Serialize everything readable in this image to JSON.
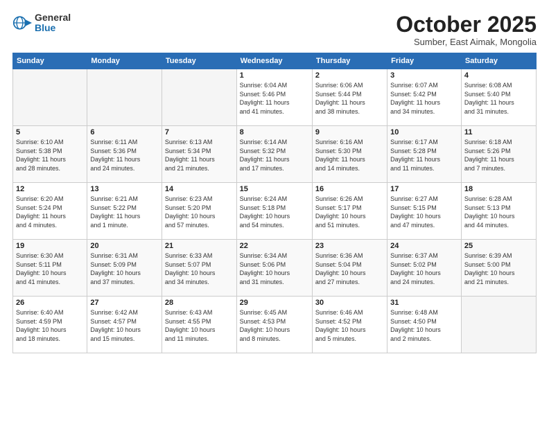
{
  "header": {
    "logo": {
      "general": "General",
      "blue": "Blue"
    },
    "title": "October 2025",
    "subtitle": "Sumber, East Aimak, Mongolia"
  },
  "days_of_week": [
    "Sunday",
    "Monday",
    "Tuesday",
    "Wednesday",
    "Thursday",
    "Friday",
    "Saturday"
  ],
  "weeks": [
    [
      {
        "day": "",
        "info": ""
      },
      {
        "day": "",
        "info": ""
      },
      {
        "day": "",
        "info": ""
      },
      {
        "day": "1",
        "info": "Sunrise: 6:04 AM\nSunset: 5:46 PM\nDaylight: 11 hours\nand 41 minutes."
      },
      {
        "day": "2",
        "info": "Sunrise: 6:06 AM\nSunset: 5:44 PM\nDaylight: 11 hours\nand 38 minutes."
      },
      {
        "day": "3",
        "info": "Sunrise: 6:07 AM\nSunset: 5:42 PM\nDaylight: 11 hours\nand 34 minutes."
      },
      {
        "day": "4",
        "info": "Sunrise: 6:08 AM\nSunset: 5:40 PM\nDaylight: 11 hours\nand 31 minutes."
      }
    ],
    [
      {
        "day": "5",
        "info": "Sunrise: 6:10 AM\nSunset: 5:38 PM\nDaylight: 11 hours\nand 28 minutes."
      },
      {
        "day": "6",
        "info": "Sunrise: 6:11 AM\nSunset: 5:36 PM\nDaylight: 11 hours\nand 24 minutes."
      },
      {
        "day": "7",
        "info": "Sunrise: 6:13 AM\nSunset: 5:34 PM\nDaylight: 11 hours\nand 21 minutes."
      },
      {
        "day": "8",
        "info": "Sunrise: 6:14 AM\nSunset: 5:32 PM\nDaylight: 11 hours\nand 17 minutes."
      },
      {
        "day": "9",
        "info": "Sunrise: 6:16 AM\nSunset: 5:30 PM\nDaylight: 11 hours\nand 14 minutes."
      },
      {
        "day": "10",
        "info": "Sunrise: 6:17 AM\nSunset: 5:28 PM\nDaylight: 11 hours\nand 11 minutes."
      },
      {
        "day": "11",
        "info": "Sunrise: 6:18 AM\nSunset: 5:26 PM\nDaylight: 11 hours\nand 7 minutes."
      }
    ],
    [
      {
        "day": "12",
        "info": "Sunrise: 6:20 AM\nSunset: 5:24 PM\nDaylight: 11 hours\nand 4 minutes."
      },
      {
        "day": "13",
        "info": "Sunrise: 6:21 AM\nSunset: 5:22 PM\nDaylight: 11 hours\nand 1 minute."
      },
      {
        "day": "14",
        "info": "Sunrise: 6:23 AM\nSunset: 5:20 PM\nDaylight: 10 hours\nand 57 minutes."
      },
      {
        "day": "15",
        "info": "Sunrise: 6:24 AM\nSunset: 5:18 PM\nDaylight: 10 hours\nand 54 minutes."
      },
      {
        "day": "16",
        "info": "Sunrise: 6:26 AM\nSunset: 5:17 PM\nDaylight: 10 hours\nand 51 minutes."
      },
      {
        "day": "17",
        "info": "Sunrise: 6:27 AM\nSunset: 5:15 PM\nDaylight: 10 hours\nand 47 minutes."
      },
      {
        "day": "18",
        "info": "Sunrise: 6:28 AM\nSunset: 5:13 PM\nDaylight: 10 hours\nand 44 minutes."
      }
    ],
    [
      {
        "day": "19",
        "info": "Sunrise: 6:30 AM\nSunset: 5:11 PM\nDaylight: 10 hours\nand 41 minutes."
      },
      {
        "day": "20",
        "info": "Sunrise: 6:31 AM\nSunset: 5:09 PM\nDaylight: 10 hours\nand 37 minutes."
      },
      {
        "day": "21",
        "info": "Sunrise: 6:33 AM\nSunset: 5:07 PM\nDaylight: 10 hours\nand 34 minutes."
      },
      {
        "day": "22",
        "info": "Sunrise: 6:34 AM\nSunset: 5:06 PM\nDaylight: 10 hours\nand 31 minutes."
      },
      {
        "day": "23",
        "info": "Sunrise: 6:36 AM\nSunset: 5:04 PM\nDaylight: 10 hours\nand 27 minutes."
      },
      {
        "day": "24",
        "info": "Sunrise: 6:37 AM\nSunset: 5:02 PM\nDaylight: 10 hours\nand 24 minutes."
      },
      {
        "day": "25",
        "info": "Sunrise: 6:39 AM\nSunset: 5:00 PM\nDaylight: 10 hours\nand 21 minutes."
      }
    ],
    [
      {
        "day": "26",
        "info": "Sunrise: 6:40 AM\nSunset: 4:59 PM\nDaylight: 10 hours\nand 18 minutes."
      },
      {
        "day": "27",
        "info": "Sunrise: 6:42 AM\nSunset: 4:57 PM\nDaylight: 10 hours\nand 15 minutes."
      },
      {
        "day": "28",
        "info": "Sunrise: 6:43 AM\nSunset: 4:55 PM\nDaylight: 10 hours\nand 11 minutes."
      },
      {
        "day": "29",
        "info": "Sunrise: 6:45 AM\nSunset: 4:53 PM\nDaylight: 10 hours\nand 8 minutes."
      },
      {
        "day": "30",
        "info": "Sunrise: 6:46 AM\nSunset: 4:52 PM\nDaylight: 10 hours\nand 5 minutes."
      },
      {
        "day": "31",
        "info": "Sunrise: 6:48 AM\nSunset: 4:50 PM\nDaylight: 10 hours\nand 2 minutes."
      },
      {
        "day": "",
        "info": ""
      }
    ]
  ]
}
